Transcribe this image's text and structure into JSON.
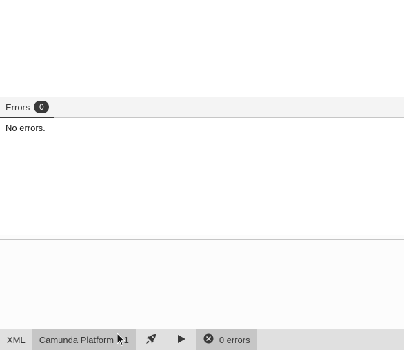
{
  "panel": {
    "tabs": [
      {
        "label": "Errors",
        "count": "0"
      }
    ],
    "message": "No errors."
  },
  "statusbar": {
    "format_label": "XML",
    "engine_label": "Camunda Platform 8.1",
    "deploy_icon": "rocket-icon",
    "run_icon": "play-icon",
    "error_icon": "error-circle-icon",
    "errors_label": "0 errors"
  },
  "colors": {
    "statusbar_bg": "#e0e0e0",
    "active_segment_bg": "#c6c6c6",
    "badge_bg": "#393939"
  }
}
